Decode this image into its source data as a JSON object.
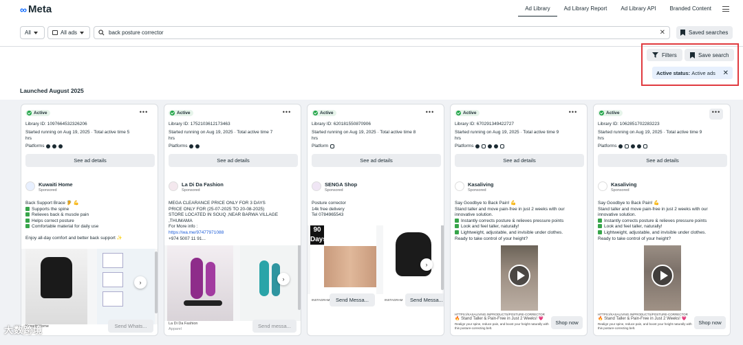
{
  "header": {
    "logo": "Meta",
    "nav": [
      "Ad Library",
      "Ad Library Report",
      "Ad Library API",
      "Branded Content"
    ]
  },
  "search": {
    "country": "All",
    "ad_type": "All ads",
    "query": "back posture corrector",
    "saved_label": "Saved searches"
  },
  "filters": {
    "filters_label": "Filters",
    "save_search_label": "Save search",
    "chip_key": "Active status:",
    "chip_value": "Active ads"
  },
  "section_title": "Launched August 2025",
  "cards": [
    {
      "status": "Active",
      "library_id": "Library ID: 1097664532326206",
      "started": "Started running on Aug 19, 2025 · Total active time 5",
      "started2": "hrs",
      "platforms_label": "Platforms",
      "details": "See ad details",
      "advertiser": "Kuwaiti Home",
      "sponsored": "Sponsored",
      "body": [
        "Back Support Brace 🦻 💪",
        "Supports the spine",
        "Relieves back & muscle pain",
        "Helps correct posture",
        "Comfortable material for daily use",
        "",
        "Enjoy all-day comfort and better back support ✨"
      ],
      "footer": "Kuwaiti Home",
      "cta": "Send Whats..."
    },
    {
      "status": "Active",
      "library_id": "Library ID: 1752103612173463",
      "started": "Started running on Aug 19, 2025 · Total active time 7",
      "started2": "hrs",
      "platforms_label": "Platforms",
      "details": "See ad details",
      "advertiser": "La Di Da Fashion",
      "sponsored": "Sponsored",
      "body": [
        "MEGA CLEARANCE PRICE ONLY FOR 3 DAYS",
        "PRICE ONLY FOR (25-07-2025 TO 20-08-2025)",
        "STORE LOCATED IN SOUQ ,NEAR BARWA VILLAGE",
        ",THUMAMA",
        "For More info :",
        "https://wa.me/97477971088",
        "+974 5007 11 91..."
      ],
      "footer": "La Di Da Fashion",
      "footer2": "Apparel",
      "cta": "Send messa..."
    },
    {
      "status": "Active",
      "library_id": "Library ID: 620181550870906",
      "started": "Started running on Aug 19, 2025 · Total active time 8",
      "started2": "hrs",
      "platforms_label": "Platform",
      "details": "See ad details",
      "advertiser": "SENGA Shop",
      "sponsored": "Sponsored",
      "body": [
        "Posture corrector",
        "14k free delivery",
        "Tel 0784965543"
      ],
      "img_text": "90 Days",
      "tag1": "INSTAGRAM",
      "cta1": "Send Messa...",
      "tag2": "INSTAGRAM",
      "cta2": "Send Messa..."
    },
    {
      "status": "Active",
      "library_id": "Library ID: 670291349422727",
      "started": "Started running on Aug 19, 2025 · Total active time 9",
      "started2": "hrs",
      "platforms_label": "Platforms",
      "details": "See ad details",
      "advertiser": "Kasaliving",
      "sponsored": "Sponsored",
      "body": [
        "Say Goodbye to Back Pain! 💪",
        "Stand taller and move pain-free in just 2 weeks with our",
        "innovative solution.",
        "Instantly corrects posture & relieves pressure points",
        "Look and feel taller, naturally!",
        "Lightweight, adjustable, and invisible under clothes.",
        "Ready to take control of your height?"
      ],
      "url": "HTTPS://KASALIVING.IN/PRODUCTS/POSTURE-CORRECTOR",
      "headline": "🔥 Stand Taller & Pain-Free in Just 2 Weeks! 💗",
      "desc": "Realign your spine, reduce pain, and boost your height naturally with this posture-correcting belt.",
      "cta": "Shop now"
    },
    {
      "status": "Active",
      "library_id": "Library ID: 1062851702283223",
      "started": "Started running on Aug 19, 2025 · Total active time 9",
      "started2": "hrs",
      "platforms_label": "Platforms",
      "details": "See ad details",
      "advertiser": "Kasaliving",
      "sponsored": "Sponsored",
      "body": [
        "Say Goodbye to Back Pain! 💪",
        "Stand taller and move pain-free in just 2 weeks with our",
        "innovative solution.",
        "Instantly corrects posture & relieves pressure points",
        "Look and feel taller, naturally!",
        "Lightweight, adjustable, and invisible under clothes.",
        "Ready to take control of your height?"
      ],
      "url": "HTTPS://KASALIVING.IN/PRODUCTS/POSTURE-CORRECTOR",
      "headline": "🔥 Stand Taller & Pain-Free in Just 2 Weeks! 💗",
      "desc": "Realign your spine, reduce pain, and boost your height naturally with this posture-correcting belt.",
      "cta": "Shop now"
    }
  ],
  "watermark": "大数跨境",
  "colors": {
    "accent": "#0866ff",
    "active": "#1fa446",
    "highlight_border": "#e0393e"
  }
}
